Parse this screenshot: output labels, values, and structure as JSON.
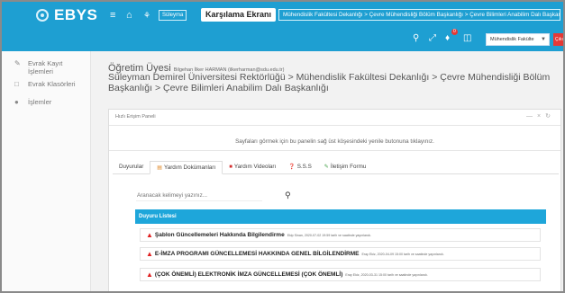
{
  "topbar": {
    "logo": "EBYS",
    "user_chip": "Süleyma",
    "home_button": "Karşılama Ekranı",
    "breadcrumb": "Mühendislik Fakültesi Dekanlığı > Çevre Mühendisliği Bölüm Başkanlığı > Çevre Bilimleri Anabilim Dalı Başkanlığı",
    "notification_count": "0",
    "unit_select": "Mühendislik Fakülte",
    "exit_label": "Çıkış"
  },
  "sidebar": {
    "items": [
      {
        "label": "Evrak Kayıt İşlemleri",
        "icon": "register-icon"
      },
      {
        "label": "Evrak Klasörleri",
        "icon": "folder-icon"
      },
      {
        "label": "İşlemler",
        "icon": "user-icon"
      }
    ]
  },
  "main": {
    "user_title": "Öğretim Üyesi",
    "user_sub": "Bilgehan İlker HARMAN (ilkerharman@sdu.edu.tr)",
    "org_path": "Süleyman Demirel Üniversitesi Rektörlüğü > Mühendislik Fakültesi Dekanlığı > Çevre Mühendisliği Bölüm Başkanlığı > Çevre Bilimleri Anabilim Dalı Başkanlığı"
  },
  "panel": {
    "title": "Hızlı Erişim Paneli",
    "info_text": "Sayfaları görmek için bu panelin sağ üst köşesindeki yenile butonuna tıklayınız.",
    "tabs": [
      {
        "label": "Duyurular",
        "icon": "",
        "color": "#444444"
      },
      {
        "label": "Yardım Dokümanları",
        "icon": "document-icon",
        "color": "#e08a2b"
      },
      {
        "label": "Yardım Videoları",
        "icon": "video-icon",
        "color": "#d32f2f"
      },
      {
        "label": "S.S.S",
        "icon": "question-icon",
        "color": "#1e88e5"
      },
      {
        "label": "İletişim Formu",
        "icon": "edit-icon",
        "color": "#43a047"
      }
    ],
    "search_placeholder": "Aranacak kelimeyi yazınız...",
    "list_header": "Duyuru Listesi",
    "announcements": [
      {
        "title": "Şablon Güncellemeleri Hakkında Bilgilendirme",
        "meta": "Ekip Sinan, 2020-07-02 19:59 tarih ve saatinde yayınlandı."
      },
      {
        "title": "E-İMZA PROGRAMI GÜNCELLEMESİ HAKKINDA GENEL BİLGİLENDİRME",
        "meta": "Eray Ekiz, 2020-04-09 15:00 tarih ve saatinde yayınlandı."
      },
      {
        "title": "(ÇOK ÖNEMLİ) ELEKTRONİK İMZA GÜNCELLEMESİ (ÇOK ÖNEMLİ)",
        "meta": "Eray Ekiz, 2020-03-31 15:00 tarih ve saatinde yayınlandı."
      }
    ]
  },
  "colors": {
    "topbar": "#1e9fd2",
    "list_header": "#1ea6da",
    "warning": "#e02020",
    "exit": "#e53935"
  }
}
